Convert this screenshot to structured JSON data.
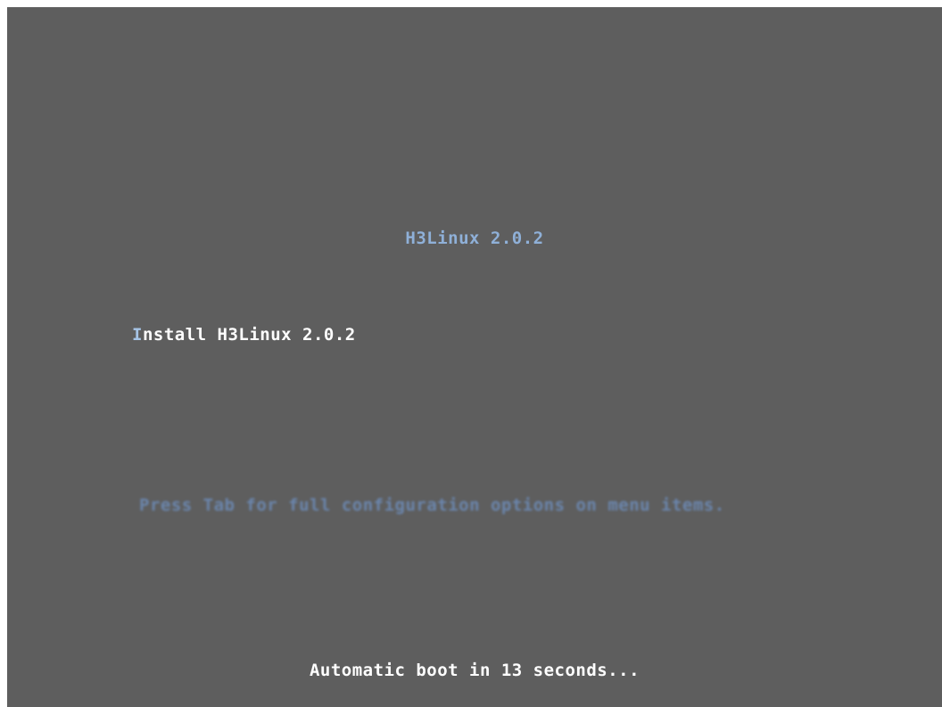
{
  "menu": {
    "title": "H3Linux 2.0.2",
    "items": [
      {
        "hotkey": "I",
        "label_rest": "nstall H3Linux 2.0.2"
      }
    ]
  },
  "help_text": "Press Tab for full configuration options on menu items.",
  "countdown": "Automatic boot in 13 seconds...",
  "colors": {
    "background": "#5e5e5e",
    "title": "#8fb0d8",
    "item_text": "#ffffff",
    "hotkey": "#a6c4e6",
    "help_text": "#6b86ad"
  }
}
